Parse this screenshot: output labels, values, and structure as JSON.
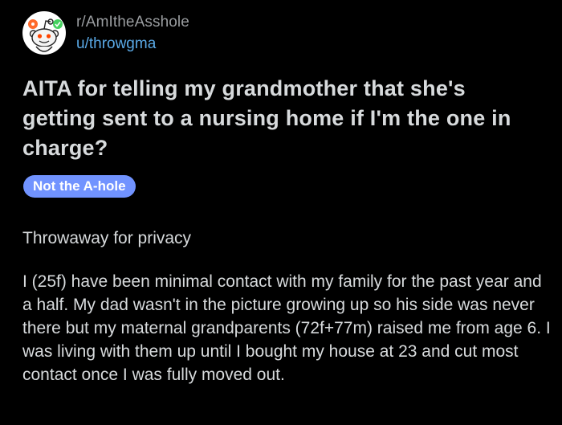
{
  "header": {
    "subreddit": "r/AmItheAsshole",
    "username": "u/throwgma",
    "avatar_icon": "reddit-snoo-avatar-icon"
  },
  "post": {
    "title": "AITA for telling my grandmother that she's getting sent to a nursing home if I'm the one in charge?",
    "flair": "Not the A-hole",
    "flair_color": "#7193ff",
    "body": [
      "Throwaway for privacy",
      "I (25f) have been minimal contact with my family for the past year and a half. My dad wasn't in the picture growing up so his side was never there but my maternal grandparents (72f+77m) raised me from age 6. I was living with them up until I bought my house at 23 and cut most contact once I was fully moved out."
    ]
  },
  "colors": {
    "background": "#000000",
    "text": "#d7dadc",
    "muted": "#9a9da0",
    "link": "#5aa9e6"
  }
}
